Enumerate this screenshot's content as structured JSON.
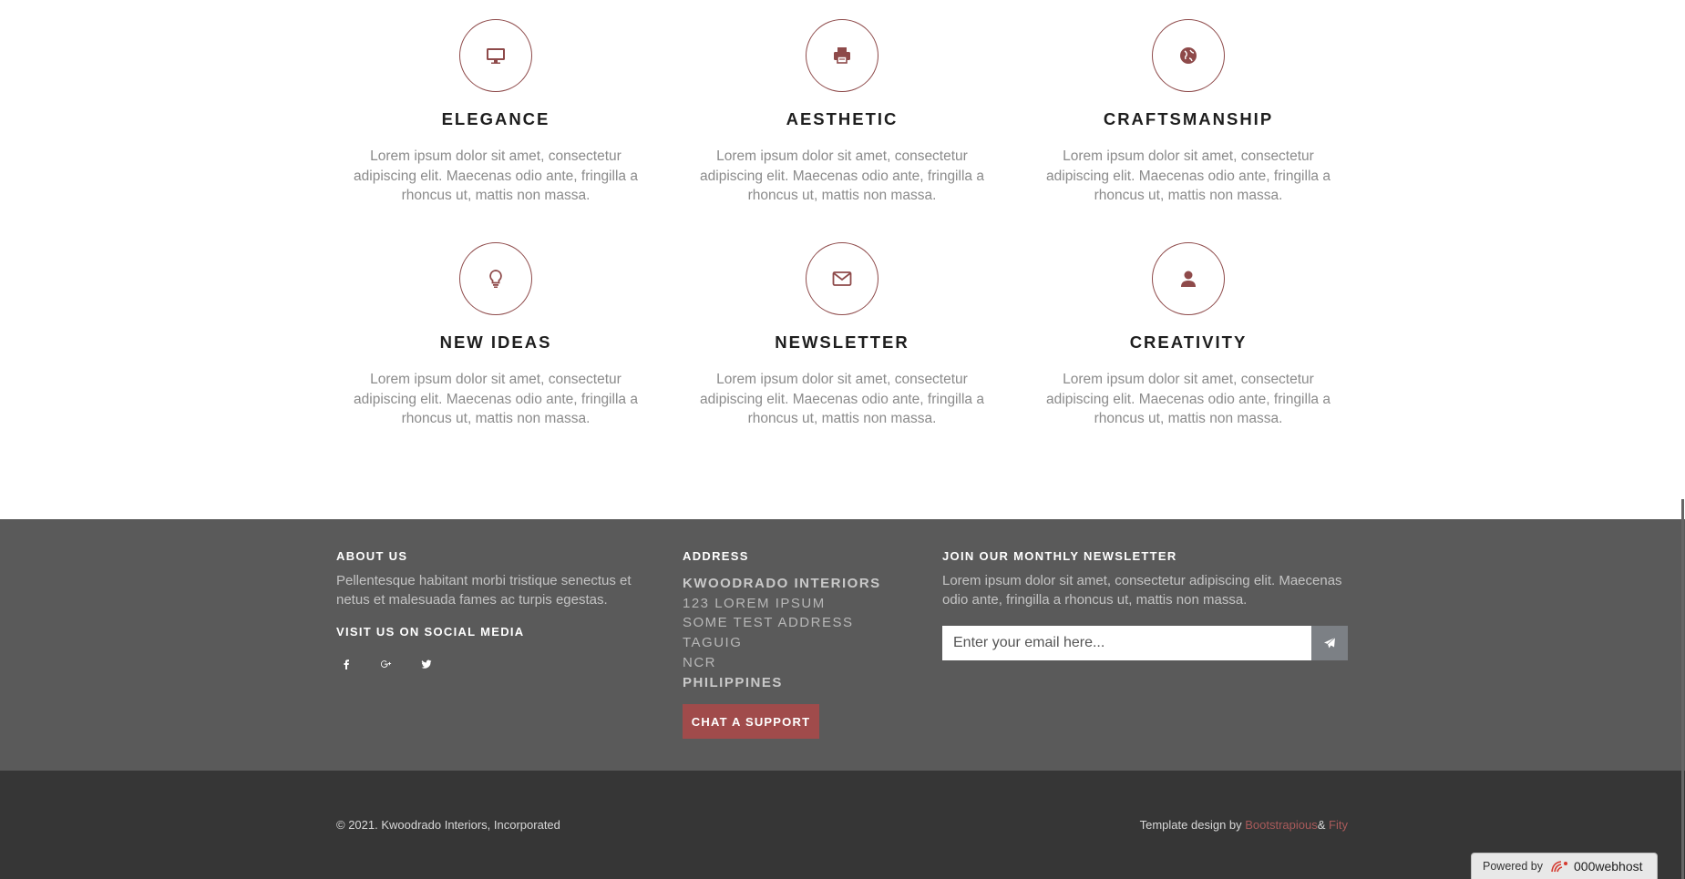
{
  "colors": {
    "accent": "#8e4a4a",
    "button": "#a04b4b",
    "footer_top_bg": "#5a5a5a",
    "footer_bottom_bg": "#363636",
    "link": "#a85a5a"
  },
  "features": [
    {
      "icon": "desktop-icon",
      "title": "ELEGANCE",
      "text": "Lorem ipsum dolor sit amet, consectetur adipiscing elit. Maecenas odio ante, fringilla a rhoncus ut, mattis non massa."
    },
    {
      "icon": "print-icon",
      "title": "AESTHETIC",
      "text": "Lorem ipsum dolor sit amet, consectetur adipiscing elit. Maecenas odio ante, fringilla a rhoncus ut, mattis non massa."
    },
    {
      "icon": "globe-icon",
      "title": "CRAFTSMANSHIP",
      "text": "Lorem ipsum dolor sit amet, consectetur adipiscing elit. Maecenas odio ante, fringilla a rhoncus ut, mattis non massa."
    },
    {
      "icon": "lightbulb-icon",
      "title": "NEW IDEAS",
      "text": "Lorem ipsum dolor sit amet, consectetur adipiscing elit. Maecenas odio ante, fringilla a rhoncus ut, mattis non massa."
    },
    {
      "icon": "envelope-icon",
      "title": "NEWSLETTER",
      "text": "Lorem ipsum dolor sit amet, consectetur adipiscing elit. Maecenas odio ante, fringilla a rhoncus ut, mattis non massa."
    },
    {
      "icon": "user-icon",
      "title": "CREATIVITY",
      "text": "Lorem ipsum dolor sit amet, consectetur adipiscing elit. Maecenas odio ante, fringilla a rhoncus ut, mattis non massa."
    }
  ],
  "footer": {
    "about_heading": "ABOUT US",
    "about_text": "Pellentesque habitant morbi tristique senectus et netus et malesuada fames ac turpis egestas.",
    "social_heading": "VISIT US ON SOCIAL MEDIA",
    "social_icons": [
      "facebook-icon",
      "google-plus-icon",
      "twitter-icon"
    ],
    "address_heading": "ADDRESS",
    "address_lines": [
      "KWOODRADO INTERIORS",
      "123 LOREM IPSUM",
      "SOME TEST ADDRESS",
      "TAGUIG",
      "NCR",
      "PHILIPPINES"
    ],
    "chat_button": "CHAT A SUPPORT",
    "newsletter_heading": "JOIN OUR MONTHLY NEWSLETTER",
    "newsletter_text": "Lorem ipsum dolor sit amet, consectetur adipiscing elit. Maecenas odio ante, fringilla a rhoncus ut, mattis non massa.",
    "email_placeholder": "Enter your email here...",
    "submit_icon": "paper-plane-icon"
  },
  "bottom": {
    "copyright": "© 2021. Kwoodrado Interiors, Incorporated",
    "credit_prefix": "Template design by ",
    "credit_link1": "Bootstrapious",
    "credit_amp": "& ",
    "credit_link2": "Fity"
  },
  "powered": {
    "label": "Powered by",
    "brand": "000webhost"
  }
}
